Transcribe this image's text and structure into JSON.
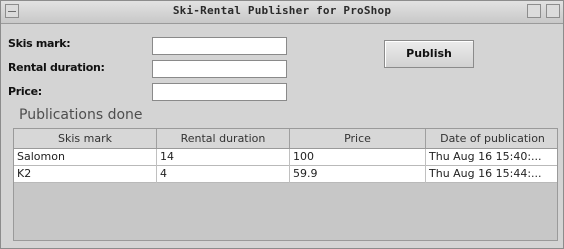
{
  "window": {
    "title": "Ski-Rental Publisher for ProShop"
  },
  "form": {
    "skis_mark_label": "Skis mark:",
    "rental_duration_label": "Rental duration:",
    "price_label": "Price:",
    "skis_mark_value": "",
    "rental_duration_value": "",
    "price_value": "",
    "publish_label": "Publish"
  },
  "publications": {
    "title": "Publications done",
    "columns": [
      "Skis mark",
      "Rental duration",
      "Price",
      "Date of publication"
    ],
    "rows": [
      [
        "Salomon",
        "14",
        "100",
        "Thu Aug 16 15:40:..."
      ],
      [
        "K2",
        "4",
        "59.9",
        "Thu Aug 16 15:44:..."
      ]
    ]
  }
}
